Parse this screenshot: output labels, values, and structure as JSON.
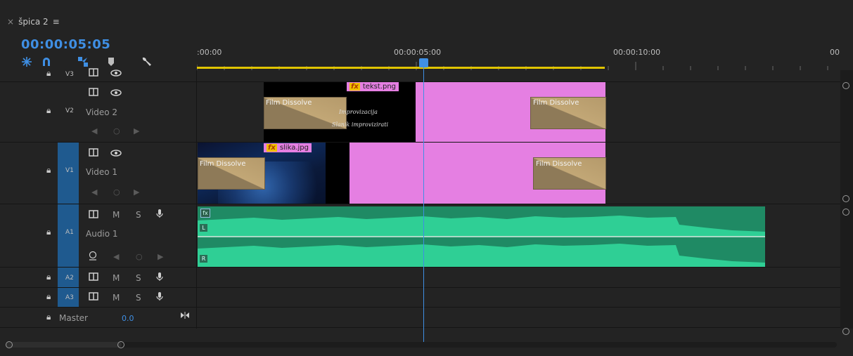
{
  "panel": {
    "close_glyph": "×",
    "title": "špica 2",
    "menu_glyph": "≡"
  },
  "timecode": "00:00:05:05",
  "ruler": {
    "labels": [
      ":00:00",
      "00:00:05:00",
      "00:00:10:00",
      "00"
    ]
  },
  "tracks": {
    "v3": {
      "name": "V3"
    },
    "v2": {
      "name": "V2",
      "label": "Video 2"
    },
    "v1": {
      "name": "V1",
      "label": "Video 1"
    },
    "a1": {
      "name": "A1",
      "label": "Audio 1",
      "m": "M",
      "s": "S"
    },
    "a2": {
      "name": "A2",
      "m": "M",
      "s": "S"
    },
    "a3": {
      "name": "A3",
      "m": "M",
      "s": "S"
    },
    "master": {
      "label": "Master",
      "value": "0.0"
    }
  },
  "clips": {
    "tekst": {
      "fx": "fx",
      "name": "tekst.png",
      "line1": "Improvizacija",
      "line2": "Slanik improvizirati"
    },
    "slika": {
      "fx": "fx",
      "name": "slika.jpg"
    },
    "dissolve": "Film Dissolve",
    "audio": {
      "fx": "fx",
      "left": "L",
      "right": "R"
    }
  },
  "colors": {
    "accent": "#3f8fe4",
    "clip_pink": "#e57fe2",
    "audio_green": "#2fcf95",
    "work_area": "#e0c400"
  }
}
